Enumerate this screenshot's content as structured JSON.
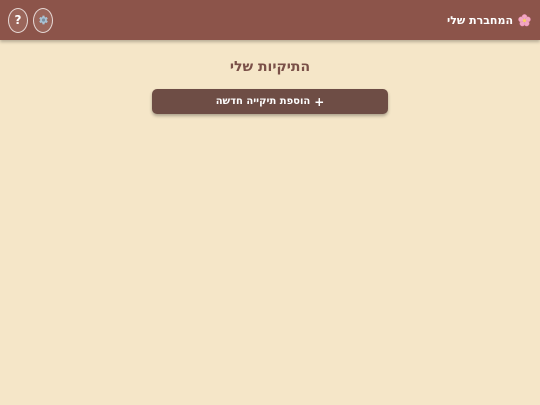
{
  "header": {
    "brand_icon": "cherry-blossom-icon",
    "brand_title": "המחברת שלי",
    "settings_icon": "gear-icon",
    "help_label": "?"
  },
  "main": {
    "title": "התיקיות שלי",
    "add_folder": {
      "icon_glyph": "+",
      "label": "הוספת תיקייה חדשה"
    }
  },
  "colors": {
    "header_bg": "#8c544a",
    "page_bg": "#f5e6c8",
    "button_bg": "#6e4d45",
    "title_text": "#7a5048",
    "blossom_pink": "#f2a7c3"
  }
}
